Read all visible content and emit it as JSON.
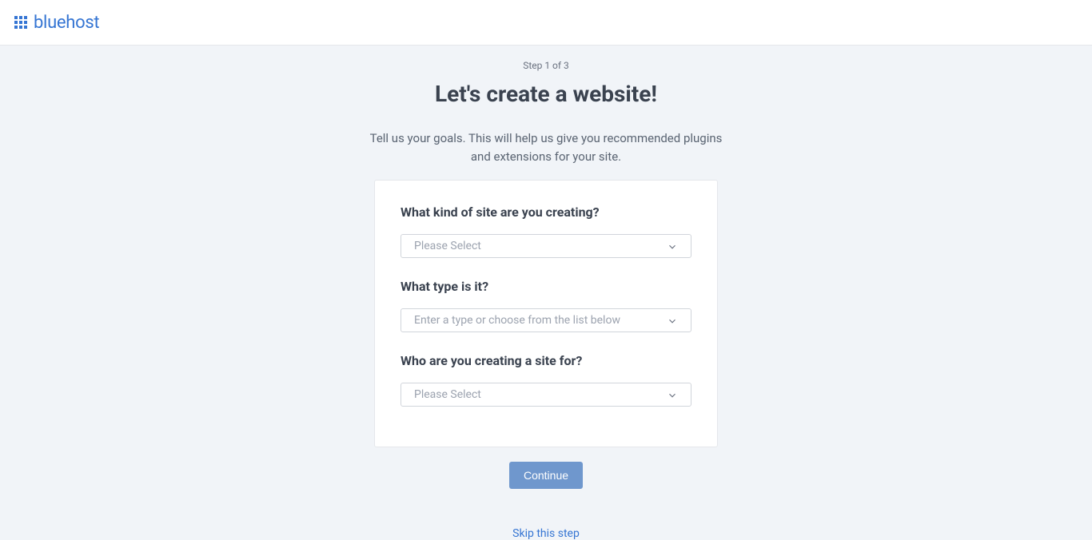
{
  "header": {
    "brand": "bluehost"
  },
  "wizard": {
    "step_label": "Step 1 of 3",
    "title": "Let's create a website!",
    "subtitle": "Tell us your goals. This will help us give you recommended plugins and extensions for your site.",
    "questions": {
      "q1": {
        "label": "What kind of site are you creating?",
        "placeholder": "Please Select"
      },
      "q2": {
        "label": "What type is it?",
        "placeholder": "Enter a type or choose from the list below"
      },
      "q3": {
        "label": "Who are you creating a site for?",
        "placeholder": "Please Select"
      }
    },
    "continue_label": "Continue",
    "skip_label": "Skip this step"
  }
}
